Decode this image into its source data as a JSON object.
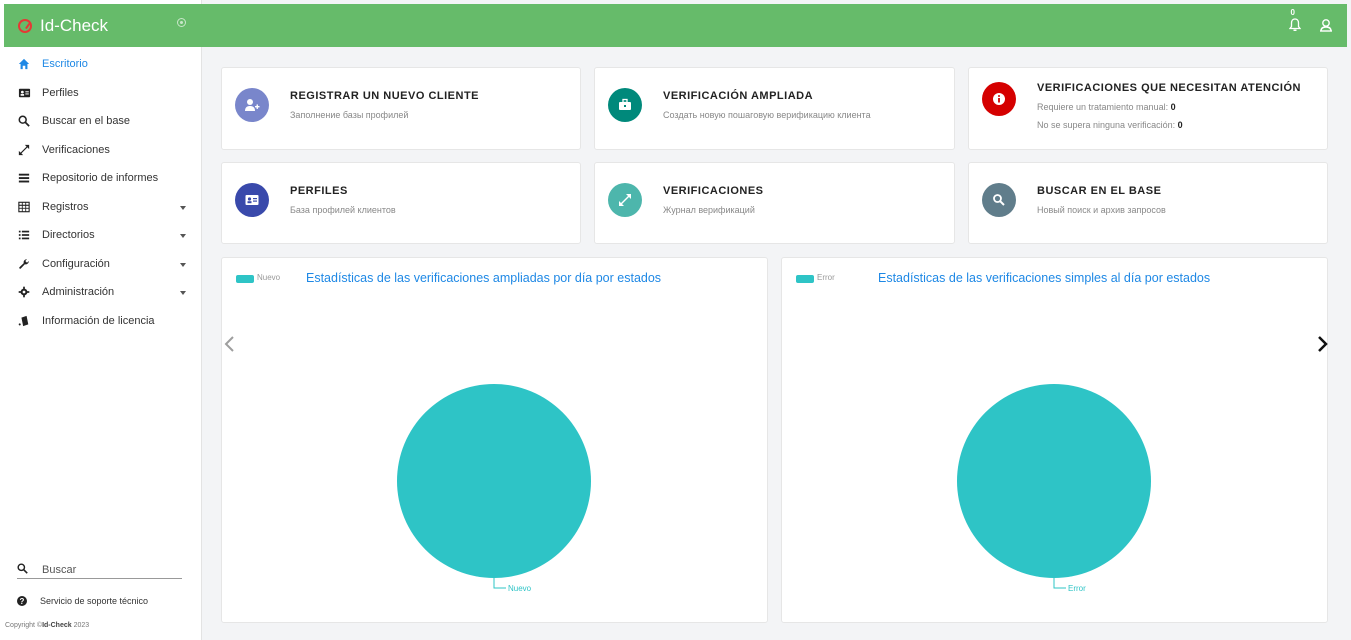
{
  "brand": {
    "title": "Id-Check"
  },
  "sidebar": {
    "items": [
      {
        "label": "Escritorio",
        "icon": "home-icon",
        "active": true
      },
      {
        "label": "Perfiles",
        "icon": "id-card-icon"
      },
      {
        "label": "Buscar en el base",
        "icon": "search-icon"
      },
      {
        "label": "Verificaciones",
        "icon": "expand-icon"
      },
      {
        "label": "Repositorio de informes",
        "icon": "list-icon"
      },
      {
        "label": "Registros",
        "icon": "table-icon",
        "dropdown": true
      },
      {
        "label": "Directorios",
        "icon": "list-bullet-icon",
        "dropdown": true
      },
      {
        "label": "Configuración",
        "icon": "wrench-icon",
        "dropdown": true
      },
      {
        "label": "Administración",
        "icon": "gear-icon",
        "dropdown": true
      },
      {
        "label": "Información de licencia",
        "icon": "license-icon"
      }
    ],
    "search_placeholder": "Buscar",
    "support_label": "Servicio de soporte técnico",
    "copyright_prefix": "Copyright ©",
    "copyright_brand": "Id-Check",
    "copyright_year": " 2023"
  },
  "header": {
    "notification_count": "0"
  },
  "cards": [
    {
      "title": "REGISTRAR UN NUEVO CLIENTE",
      "subtitle": "Заполнение базы профилей",
      "color": "#7986cb",
      "icon": "add-user-icon"
    },
    {
      "title": "VERIFICACIÓN AMPLIADA",
      "subtitle": "Создать новую пошаговую верификацию клиента",
      "color": "#00897b",
      "icon": "briefcase-icon"
    },
    {
      "title": "VERIFICACIONES QUE NECESITAN ATENCIÓN",
      "line1_label": "Requiere un tratamiento manual: ",
      "line1_value": "0",
      "line2_label": "No se supera ninguna verificación: ",
      "line2_value": "0",
      "color": "#d50000",
      "icon": "info-icon"
    },
    {
      "title": "PERFILES",
      "subtitle": "База профилей клиентов",
      "color": "#3949ab",
      "icon": "id-card-icon"
    },
    {
      "title": "VERIFICACIONES",
      "subtitle": "Журнал верификаций",
      "color": "#4db6ac",
      "icon": "expand-icon"
    },
    {
      "title": "BUSCAR EN EL BASE",
      "subtitle": "Новый поиск и архив запросов",
      "color": "#607d8b",
      "icon": "search-icon"
    }
  ],
  "chart_data": [
    {
      "type": "pie",
      "title": "Estadísticas de las verificaciones ampliadas por día por estados",
      "legend": [
        "Nuevo"
      ],
      "categories": [
        "Nuevo"
      ],
      "values": [
        100
      ],
      "colors": [
        "#2ec4c6"
      ],
      "legend_position": "top-left"
    },
    {
      "type": "pie",
      "title": "Estadísticas de las verificaciones simples al día por estados",
      "legend": [
        "Error"
      ],
      "categories": [
        "Error"
      ],
      "values": [
        100
      ],
      "colors": [
        "#2ec4c6"
      ],
      "legend_position": "top-left"
    }
  ]
}
